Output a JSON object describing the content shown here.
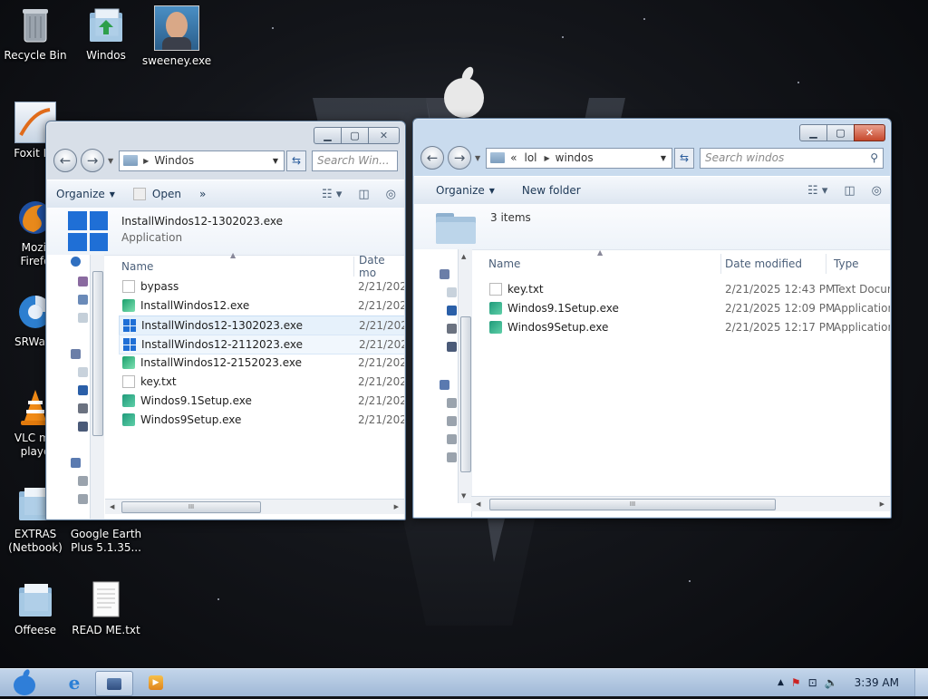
{
  "desktop": {
    "icons": [
      {
        "label": "Recycle Bin",
        "icon": "recycle-bin-icon"
      },
      {
        "label": "Windos",
        "icon": "folder-icon"
      },
      {
        "label": "sweeney.exe",
        "icon": "person-photo-icon"
      },
      {
        "label": "Foxit Re",
        "icon": "foxit-reader-icon"
      },
      {
        "label": "Mozil\nFirefo",
        "icon": "firefox-icon"
      },
      {
        "label": "SRWare",
        "icon": "srware-iron-icon"
      },
      {
        "label": "VLC me\nplaye",
        "icon": "vlc-cone-icon"
      },
      {
        "label": "EXTRAS\n(Netbook)",
        "icon": "folder-icon"
      },
      {
        "label": "Google Earth\nPlus 5.1.35...",
        "icon": "google-earth-icon"
      },
      {
        "label": "Offeese",
        "icon": "folder-icon"
      },
      {
        "label": "READ ME.txt",
        "icon": "text-file-icon"
      }
    ]
  },
  "left_window": {
    "address": [
      "Windos"
    ],
    "search_placeholder": "Search Win...",
    "toolbar": {
      "organize": "Organize",
      "open": "Open",
      "more": "»"
    },
    "details": {
      "name": "InstallWindos12-1302023.exe",
      "type": "Application"
    },
    "columns": {
      "name": "Name",
      "date": "Date mo"
    },
    "files": [
      {
        "name": "bypass",
        "date": "2/21/202",
        "icon": "blank-file-icon"
      },
      {
        "name": "InstallWindos12.exe",
        "date": "2/21/202",
        "icon": "installer-icon"
      },
      {
        "name": "InstallWindos12-1302023.exe",
        "date": "2/21/202",
        "icon": "windows-logo-icon"
      },
      {
        "name": "InstallWindos12-2112023.exe",
        "date": "2/21/202",
        "icon": "windows-logo-icon"
      },
      {
        "name": "InstallWindos12-2152023.exe",
        "date": "2/21/202",
        "icon": "installer-icon"
      },
      {
        "name": "key.txt",
        "date": "2/21/202",
        "icon": "text-file-icon"
      },
      {
        "name": "Windos9.1Setup.exe",
        "date": "2/21/202",
        "icon": "setup-icon"
      },
      {
        "name": "Windos9Setup.exe",
        "date": "2/21/202",
        "icon": "setup-icon"
      }
    ],
    "selected_index": 2,
    "hover_index": 3
  },
  "right_window": {
    "address": [
      "lol",
      "windos"
    ],
    "address_prefix": "«",
    "search_placeholder": "Search windos",
    "toolbar": {
      "organize": "Organize",
      "new_folder": "New folder"
    },
    "details": {
      "count": "3 items"
    },
    "columns": {
      "name": "Name",
      "date": "Date modified",
      "type": "Type"
    },
    "files": [
      {
        "name": "key.txt",
        "date": "2/21/2025 12:43 PM",
        "type": "Text Docur",
        "icon": "text-file-icon"
      },
      {
        "name": "Windos9.1Setup.exe",
        "date": "2/21/2025 12:09 PM",
        "type": "Application",
        "icon": "setup-icon"
      },
      {
        "name": "Windos9Setup.exe",
        "date": "2/21/2025 12:17 PM",
        "type": "Application",
        "icon": "setup-icon"
      }
    ]
  },
  "taskbar": {
    "clock": "3:39 AM",
    "tray_chevron": "▲"
  }
}
